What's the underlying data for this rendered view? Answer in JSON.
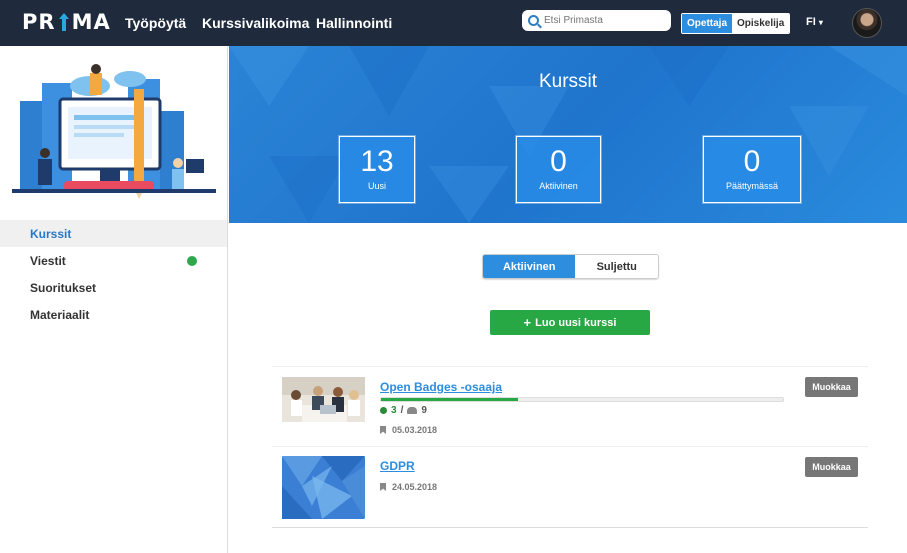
{
  "header": {
    "logo": "PRIMA",
    "nav": [
      "Työpöytä",
      "Kurssivalikoima",
      "Hallinnointi"
    ],
    "search_placeholder": "Etsi Primasta",
    "roles": [
      "Opettaja",
      "Opiskelija"
    ],
    "language": "FI",
    "active_role": "Opettaja"
  },
  "sidebar": {
    "items": [
      {
        "label": "Kurssit",
        "active": true
      },
      {
        "label": "Viestit",
        "has_indicator": true
      },
      {
        "label": "Suoritukset"
      },
      {
        "label": "Materiaalit"
      }
    ]
  },
  "hero": {
    "title": "Kurssit",
    "stats": [
      {
        "value": "13",
        "label": "Uusi"
      },
      {
        "value": "0",
        "label": "Aktiivinen"
      },
      {
        "value": "0",
        "label": "Päättymässä"
      }
    ]
  },
  "filter": {
    "options": [
      "Aktiivinen",
      "Suljettu"
    ],
    "selected": "Aktiivinen"
  },
  "create_button": "Luo uusi kurssi",
  "courses": [
    {
      "title": "Open Badges -osaaja",
      "progress": 0.34,
      "badges": "3",
      "participants": "9",
      "date": "05.03.2018",
      "edit": "Muokkaa"
    },
    {
      "title": "GDPR",
      "date": "24.05.2018",
      "edit": "Muokkaa"
    }
  ],
  "colors": {
    "topbar": "#1f2b3d",
    "accent": "#2d8ee0",
    "success": "#27a844"
  }
}
